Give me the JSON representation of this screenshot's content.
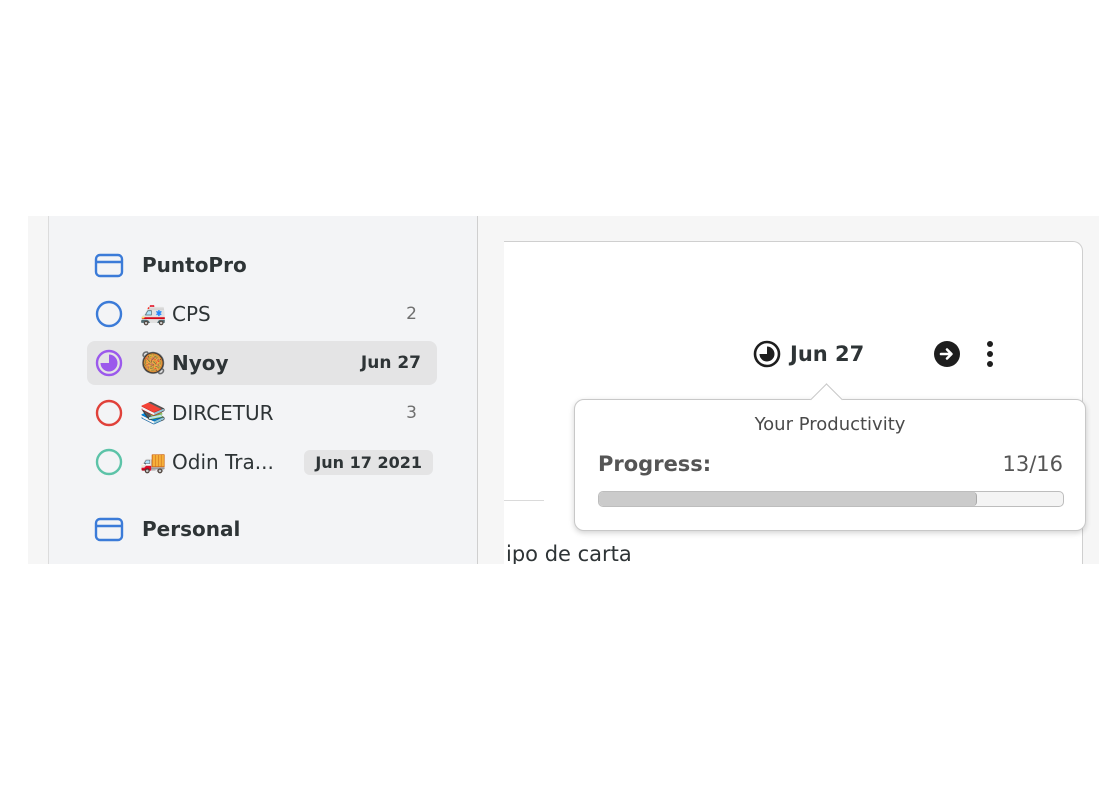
{
  "sidebar": {
    "groups": [
      {
        "label": "PuntoPro",
        "icon": "folder-icon",
        "projects": [
          {
            "emoji": "🚑",
            "label": "CPS",
            "count": "2",
            "color": "#3b7bd8"
          },
          {
            "emoji": "🥘",
            "label": "Nyoy",
            "date": "Jun 27",
            "color": "#9b59ec",
            "selected": true
          },
          {
            "emoji": "📚",
            "label": "DIRCETUR",
            "count": "3",
            "color": "#e0413a"
          },
          {
            "emoji": "🚚",
            "label": "Odin Tra...",
            "date": "Jun 17 2021",
            "color": "#5cc3a8"
          }
        ]
      },
      {
        "label": "Personal",
        "icon": "folder-icon"
      }
    ]
  },
  "task": {
    "due_date": "Jun 27",
    "content_fragment": "ipo de carta"
  },
  "popover": {
    "title": "Your Productivity",
    "progress_label": "Progress:",
    "progress_value": "13/16",
    "progress_fraction": 0.8125
  },
  "colors": {
    "folder": "#3b7bd8",
    "sidebar_bg": "#f3f4f6",
    "selected_bg": "#e4e4e5"
  }
}
